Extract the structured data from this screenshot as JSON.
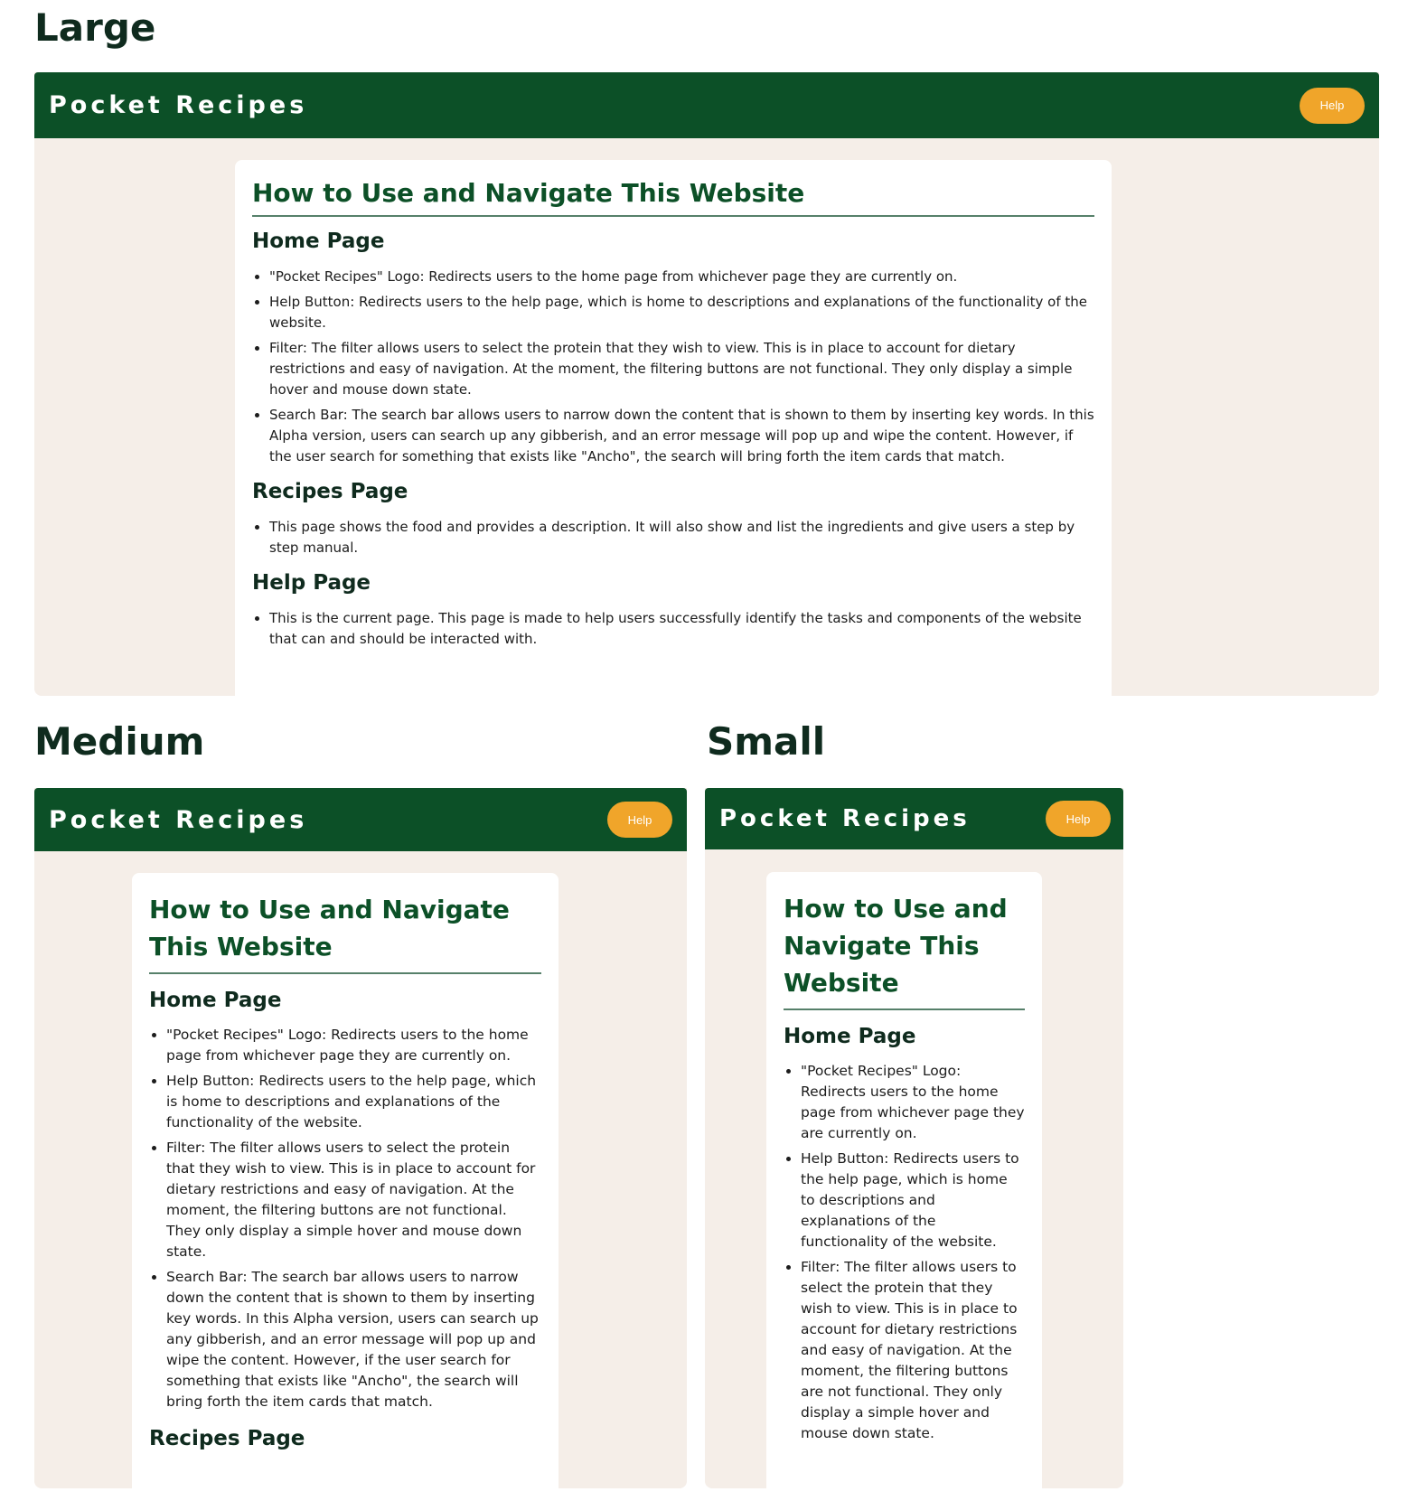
{
  "labels": {
    "large": "Large",
    "medium": "Medium",
    "small": "Small"
  },
  "site": {
    "logo": "Pocket Recipes",
    "help_label": "Help"
  },
  "colors": {
    "header_bg": "#0c5027",
    "help_bg": "#f0a52a",
    "page_bg": "#f5eee8",
    "heading": "#0c5027"
  },
  "content": {
    "title": "How to Use and Navigate This Website",
    "home": {
      "heading": "Home Page",
      "items": [
        "\"Pocket Recipes\" Logo: Redirects users to the home page from whichever page they are currently on.",
        "Help Button: Redirects users to the help page, which is home to descriptions and explanations of the functionality of the website.",
        "Filter: The filter allows users to select the protein that they wish to view. This is in place to account for dietary restrictions and easy of navigation. At the moment, the filtering buttons are not functional. They only display a simple hover and mouse down state.",
        "Search Bar: The search bar allows users to narrow down the content that is shown to them by inserting key words. In this Alpha version, users can search up any gibberish, and an error message will pop up and wipe the content. However, if the user search for something that exists like \"Ancho\", the search will bring forth the item cards that match."
      ]
    },
    "recipes": {
      "heading": "Recipes Page",
      "items": [
        "This page shows the food and provides a description. It will also show and list the ingredients and give users a step by step manual."
      ]
    },
    "help": {
      "heading": "Help Page",
      "items": [
        "This is the current page. This page is made to help users successfully identify the tasks and components of the website that can and should be interacted with."
      ]
    }
  }
}
